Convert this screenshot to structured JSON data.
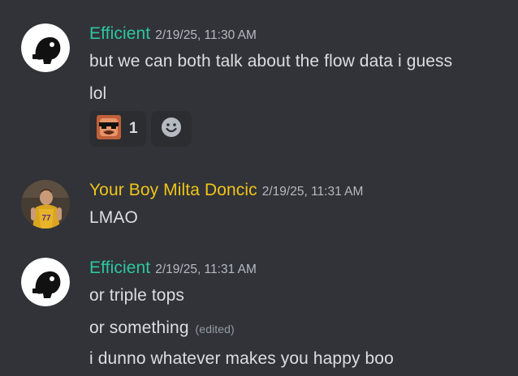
{
  "messages": [
    {
      "username": "Efficient",
      "timestamp": "2/19/25, 11:30 AM",
      "username_color": "#2dc6a0",
      "lines": [
        "but we can both talk about the flow data i guess",
        "lol"
      ],
      "reactions": [
        {
          "emoji": "sunglasses-man-emoji",
          "count": "1"
        }
      ],
      "add_reaction_icon": "smiley-add-reaction-icon"
    },
    {
      "username": "Your Boy Milta Doncic",
      "timestamp": "2/19/25, 11:31 AM",
      "username_color": "#f0c419",
      "lines": [
        "LMAO"
      ]
    },
    {
      "username": "Efficient",
      "timestamp": "2/19/25, 11:31 AM",
      "username_color": "#2dc6a0",
      "lines": [
        "or triple tops",
        "or something",
        "i dunno whatever makes you happy boo"
      ],
      "edited_label": "(edited)"
    }
  ]
}
